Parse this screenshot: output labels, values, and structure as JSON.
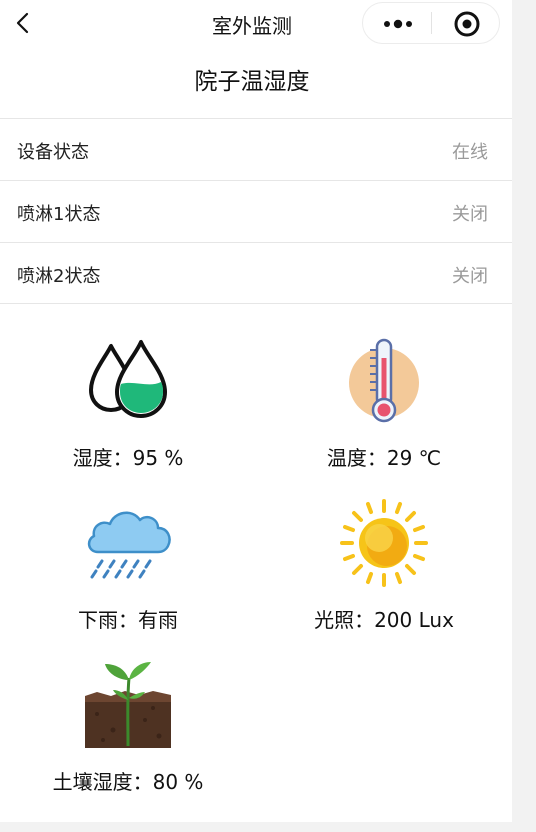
{
  "nav": {
    "back_icon": "chevron-left-icon",
    "title": "室外监测",
    "more_icon": "more-dots-icon",
    "close_icon": "target-icon"
  },
  "page_title": "院子温湿度",
  "status_rows": [
    {
      "label": "设备状态",
      "value": "在线"
    },
    {
      "label": "喷淋1状态",
      "value": "关闭"
    },
    {
      "label": "喷淋2状态",
      "value": "关闭"
    }
  ],
  "sensors": {
    "humidity": {
      "label": "湿度：95 %",
      "icon": "water-drops-icon"
    },
    "temperature": {
      "label": "温度：29 ℃",
      "icon": "thermometer-icon"
    },
    "rain": {
      "label": "下雨：有雨",
      "icon": "rain-cloud-icon"
    },
    "light": {
      "label": "光照：200 Lux",
      "icon": "sun-icon"
    },
    "soil": {
      "label": "土壤湿度：80 %",
      "icon": "seedling-icon"
    }
  },
  "colors": {
    "water_green": "#1fb87a",
    "thermo_bg": "#f3c999",
    "cloud_blue": "#7fc3f0",
    "sun_yellow": "#f7c21a"
  }
}
